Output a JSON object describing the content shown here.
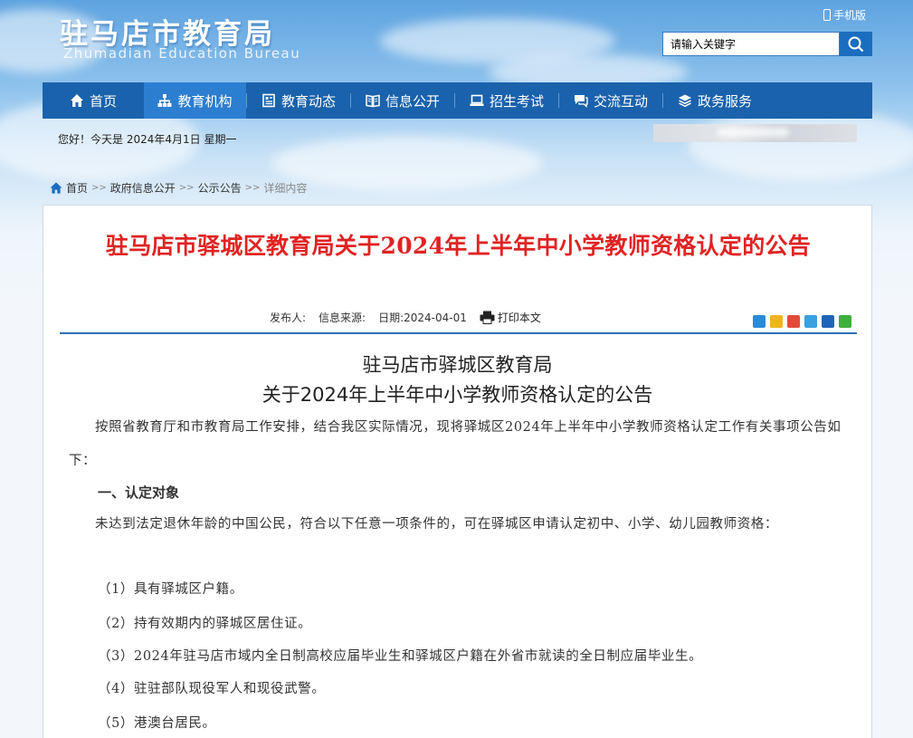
{
  "header": {
    "site_title": "驻马店市教育局",
    "site_subtitle": "Zhumadian Education Bureau",
    "mobile_label": "手机版",
    "search_placeholder": "请输入关键字"
  },
  "nav": {
    "items": [
      {
        "label": "首页",
        "icon": "home-icon"
      },
      {
        "label": "教育机构",
        "icon": "org-chart-icon"
      },
      {
        "label": "教育动态",
        "icon": "news-icon"
      },
      {
        "label": "信息公开",
        "icon": "book-icon"
      },
      {
        "label": "招生考试",
        "icon": "laptop-icon"
      },
      {
        "label": "交流互动",
        "icon": "chat-icon"
      },
      {
        "label": "政务服务",
        "icon": "layers-icon"
      }
    ],
    "active_index": 1
  },
  "greeting": "您好！今天是 2024年4月1日 星期一",
  "breadcrumb": {
    "items": [
      "首页",
      "政府信息公开",
      "公示公告",
      "详细内容"
    ],
    "separator": ">>"
  },
  "article": {
    "title": "驻马店市驿城区教育局关于2024年上半年中小学教师资格认定的公告",
    "meta": {
      "publisher_label": "发布人:",
      "source_label": "信息来源:",
      "date_label": "日期:",
      "date_value": "2024-04-01",
      "print_label": "打印本文"
    },
    "share_icons": [
      "plus-share-icon",
      "qzone-icon",
      "weibo-icon",
      "tencent-icon",
      "renren-icon",
      "wechat-icon"
    ],
    "body_heading_line1": "驻马店市驿城区教育局",
    "body_heading_line2": "关于2024年上半年中小学教师资格认定的公告",
    "intro": "按照省教育厅和市教育局工作安排，结合我区实际情况，现将驿城区2024年上半年中小学教师资格认定工作有关事项公告如下：",
    "section1_title": "一、认定对象",
    "section1_intro": "未达到法定退休年龄的中国公民，符合以下任意一项条件的，可在驿城区申请认定初中、小学、幼儿园教师资格：",
    "conditions": [
      "（1）具有驿城区户籍。",
      "（2）持有效期内的驿城区居住证。",
      "（3）2024年驻马店市域内全日制高校应届毕业生和驿城区户籍在外省市就读的全日制应届毕业生。",
      "（4）驻驻部队现役军人和现役武警。",
      "（5）港澳台居民。"
    ]
  },
  "colors": {
    "nav_bg": "#1a62ac",
    "nav_active": "#2c7ed0",
    "title_red": "#e02323",
    "rule_blue": "#2d6fb3"
  }
}
